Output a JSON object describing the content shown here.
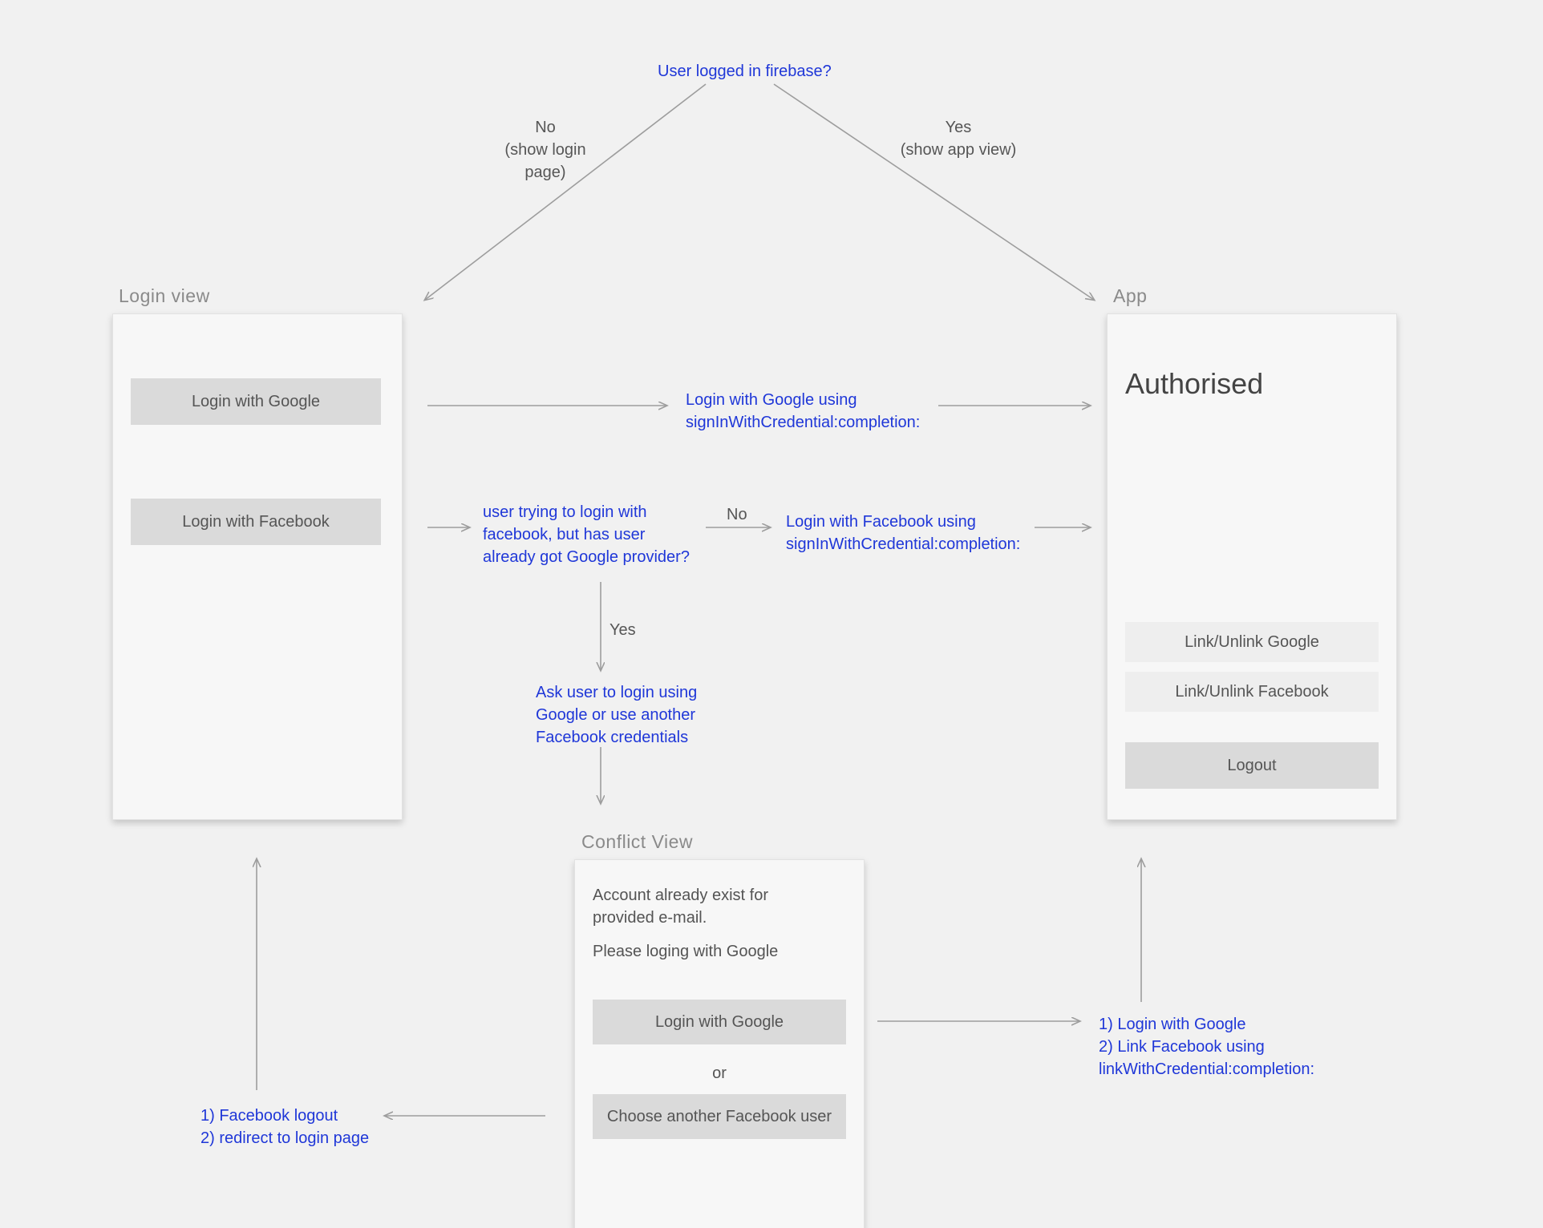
{
  "root_question": "User logged in firebase?",
  "branch_no": {
    "answer": "No",
    "hint": "(show login page)"
  },
  "branch_yes": {
    "answer": "Yes",
    "hint": "(show app view)"
  },
  "login_view": {
    "title": "Login view",
    "google_btn": "Login with Google",
    "facebook_btn": "Login with Facebook"
  },
  "app_view": {
    "title": "App",
    "heading": "Authorised",
    "link_google": "Link/Unlink Google",
    "link_facebook": "Link/Unlink Facebook",
    "logout": "Logout"
  },
  "flow": {
    "google_login_action": "Login with Google using signInWithCredential:completion:",
    "facebook_check": "user trying to login with facebook, but has user already got Google provider?",
    "facebook_check_no": "No",
    "facebook_login_action": "Login with Facebook using signInWithCredential:completion:",
    "facebook_check_yes": "Yes",
    "conflict_prompt": "Ask user to login using Google or use another Facebook credentials"
  },
  "conflict_view": {
    "title": "Conflict View",
    "msg_line1": "Account already exist for provided e-mail.",
    "msg_line2": "Please loging with Google",
    "google_btn": "Login with Google",
    "or": "or",
    "other_fb_btn": "Choose another Facebook user"
  },
  "conflict_outcome_right_1": "1) Login with Google",
  "conflict_outcome_right_2": "2) Link Facebook using linkWithCredential:completion:",
  "conflict_outcome_left_1": "1) Facebook logout",
  "conflict_outcome_left_2": "2) redirect to login page"
}
